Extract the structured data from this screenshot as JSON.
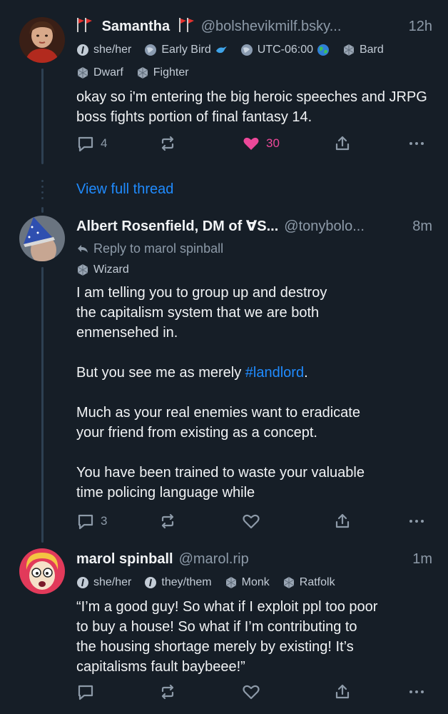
{
  "posts": [
    {
      "name_flags_left": "🚩🚩",
      "display_name": "Samantha",
      "handle": "@bolshevikmilf.bsky...",
      "time": "12h",
      "badges": [
        {
          "icon": "info-circle-icon",
          "label": "she/her",
          "trailing": ""
        },
        {
          "icon": "globe-icon",
          "label": "Early Bird",
          "trailing": "bird-icon"
        },
        {
          "icon": "globe-icon",
          "label": "UTC-06:00",
          "trailing": "earth-globe-icon"
        },
        {
          "icon": "d20-icon",
          "label": "Bard",
          "trailing": ""
        },
        {
          "icon": "d20-icon",
          "label": "Dwarf",
          "trailing": ""
        },
        {
          "icon": "d20-icon",
          "label": "Fighter",
          "trailing": ""
        }
      ],
      "text": [
        "okay so i'm entering the big heroic speeches and JRPG boss fights portion of final fantasy 14."
      ],
      "replies": "4",
      "reposts": "",
      "likes": "30"
    },
    {
      "display_name": "Albert Rosenfield, DM of ∀S...",
      "handle": "@tonybolo...",
      "time": "8m",
      "reply_to": "Reply to marol spinball",
      "badges": [
        {
          "icon": "d20-icon",
          "label": "Wizard",
          "trailing": ""
        }
      ],
      "text_lines": [
        "I am telling you to group up and destroy",
        "the capitalism system that we are both",
        "enmensehed in.",
        "",
        "But you see me as merely ",
        "",
        "Much as your real enemies want to eradicate",
        "your friend from existing as a concept.",
        "",
        "You have been trained to waste your valuable",
        "time policing language while"
      ],
      "hashtag": "#landlord",
      "hashtag_after": ".",
      "replies": "3",
      "reposts": "",
      "likes": ""
    },
    {
      "display_name": "marol spinball",
      "handle": "@marol.rip",
      "time": "1m",
      "badges": [
        {
          "icon": "info-circle-icon",
          "label": "she/her",
          "trailing": ""
        },
        {
          "icon": "info-circle-icon",
          "label": "they/them",
          "trailing": ""
        },
        {
          "icon": "d20-icon",
          "label": "Monk",
          "trailing": ""
        },
        {
          "icon": "d20-icon",
          "label": "Ratfolk",
          "trailing": ""
        }
      ],
      "text_lines": [
        "“I’m a good guy! So what if I exploit ppl too poor",
        "to buy a house! So what if I’m contributing to",
        "the housing shortage merely by existing! It’s",
        "capitalisms fault baybeee!”"
      ],
      "replies": "",
      "reposts": "",
      "likes": ""
    }
  ],
  "view_full_thread": "View full thread",
  "colors": {
    "background": "#161e27",
    "text": "#f1f3f5",
    "muted": "#8d9aa8",
    "link": "#208bfe",
    "like": "#ec4899",
    "flag": "#e5322e"
  }
}
